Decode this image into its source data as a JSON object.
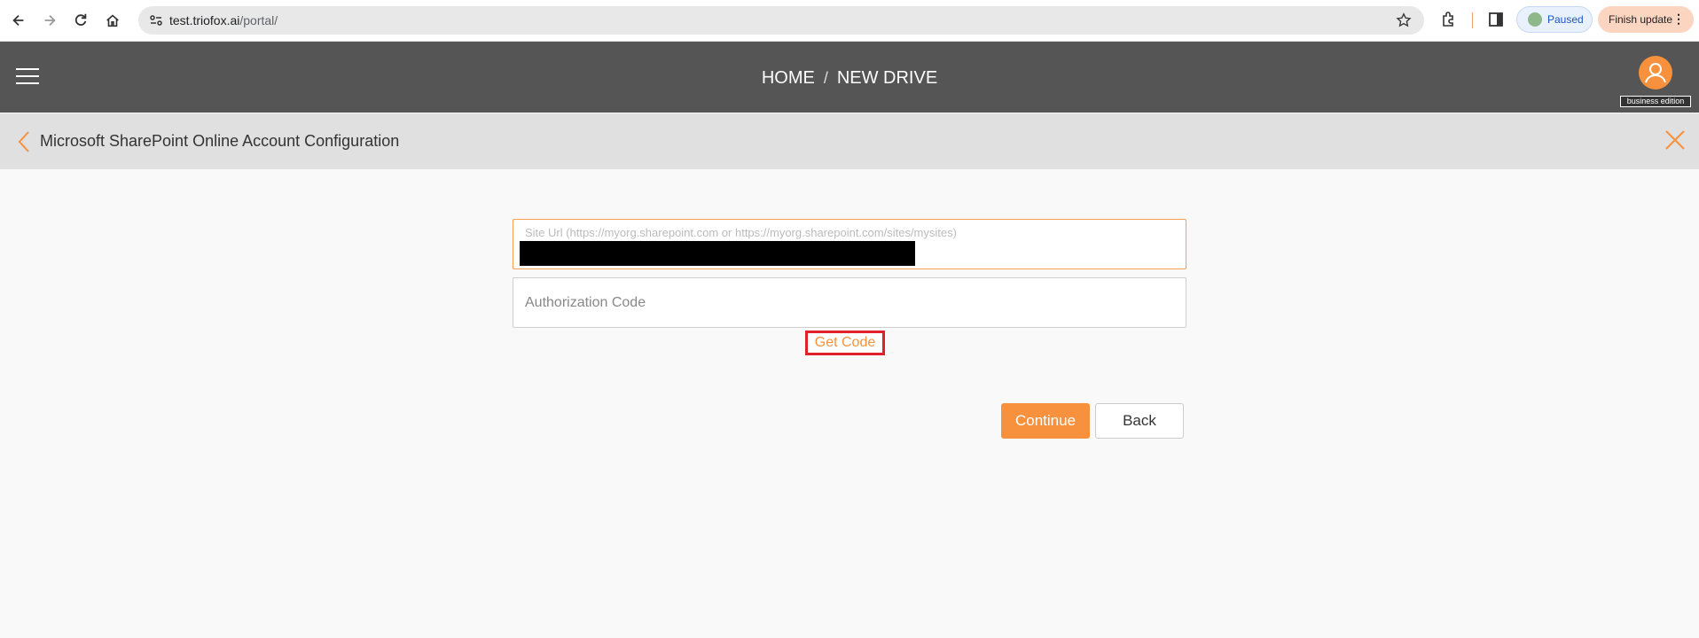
{
  "browser": {
    "url_host": "test.triofox.ai",
    "url_path": "/portal/",
    "profile_status": "Paused",
    "update_label": "Finish update"
  },
  "header": {
    "breadcrumb_home": "HOME",
    "breadcrumb_sep": "/",
    "breadcrumb_current": "NEW DRIVE",
    "edition": "business edition"
  },
  "page": {
    "title": "Microsoft SharePoint Online Account Configuration"
  },
  "form": {
    "site_url_label": "Site Url (https://myorg.sharepoint.com or https://myorg.sharepoint.com/sites/mysites)",
    "auth_code_placeholder": "Authorization Code",
    "get_code_label": "Get Code",
    "continue_label": "Continue",
    "back_label": "Back"
  },
  "colors": {
    "accent": "#f7913d",
    "header_bg": "#555555",
    "highlight": "#e0202a"
  }
}
